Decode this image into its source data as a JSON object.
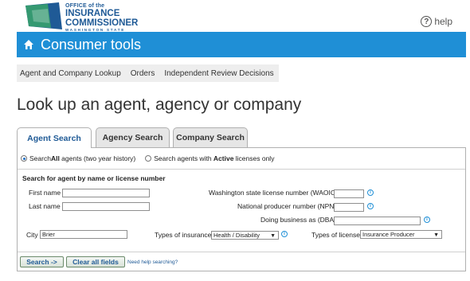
{
  "logo": {
    "line1": "OFFICE of the",
    "line2": "INSURANCE",
    "line3": "COMMISSIONER",
    "line4": "WASHINGTON STATE",
    "icon": "washington-state-logo"
  },
  "help": {
    "label": "help",
    "icon": "question-circle-icon"
  },
  "banner": {
    "title": "Consumer tools",
    "icon": "home-icon"
  },
  "subnav": {
    "items": [
      "Agent and Company Lookup",
      "Orders",
      "Independent Review Decisions"
    ]
  },
  "page_heading": "Look up an agent, agency or company",
  "tabs": [
    {
      "label": "Agent Search",
      "active": true
    },
    {
      "label": "Agency Search",
      "active": false
    },
    {
      "label": "Company Search",
      "active": false
    }
  ],
  "scope": {
    "opt1_pre": "Search ",
    "opt1_bold": "All",
    "opt1_post": " agents (two year history)",
    "opt2_pre": "Search agents with ",
    "opt2_bold": "Active",
    "opt2_post": " licenses only",
    "selected": "all"
  },
  "form": {
    "section_title": "Search for agent by name or license number",
    "first_name_label": "First name",
    "first_name_value": "",
    "last_name_label": "Last name",
    "last_name_value": "",
    "waoic_label": "Washington state license number (WAOIC)",
    "waoic_value": "",
    "npn_label": "National producer number (NPN)",
    "npn_value": "",
    "dba_label": "Doing business as (DBA)",
    "dba_value": "",
    "city_label": "City",
    "city_value": "Brier",
    "insurance_type_label": "Types of insurance",
    "insurance_type_value": "Health / Disability",
    "license_type_label": "Types of license",
    "license_type_value": "Insurance Producer"
  },
  "actions": {
    "search_label": "Search ->",
    "clear_label": "Clear all fields",
    "help_link": "Need help searching?"
  },
  "colors": {
    "banner": "#1f8fd6",
    "brand_navy": "#1f5a96",
    "brand_green": "#3aa56b"
  }
}
